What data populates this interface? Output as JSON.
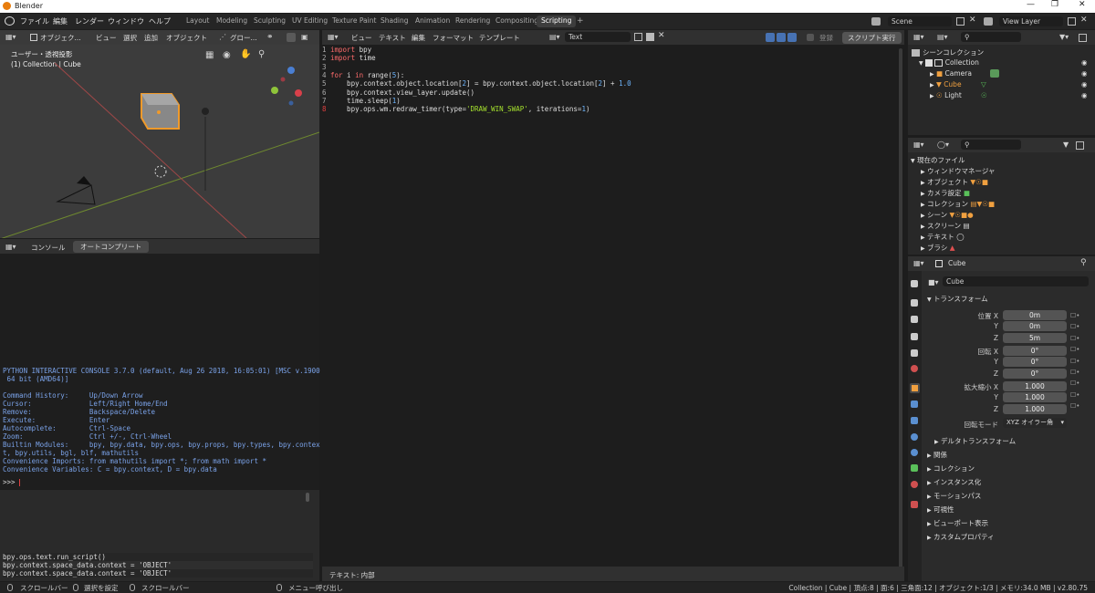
{
  "window": {
    "title": "Blender"
  },
  "menu": [
    "ファイル",
    "編集",
    "レンダー",
    "ウィンドウ",
    "ヘルプ"
  ],
  "workspaces": [
    "Layout",
    "Modeling",
    "Sculpting",
    "UV Editing",
    "Texture Paint",
    "Shading",
    "Animation",
    "Rendering",
    "Compositing",
    "Scripting"
  ],
  "active_workspace": "Scripting",
  "scene_name": "Scene",
  "view_layer": "View Layer",
  "viewport": {
    "mode": "オブジェク...",
    "menus": [
      "ビュー",
      "選択",
      "追加",
      "オブジェクト"
    ],
    "transform": "グロー...",
    "title": "ユーザー・透視投影",
    "subtitle": "(1) Collection | Cube"
  },
  "text_editor": {
    "menus": [
      "ビュー",
      "テキスト",
      "編集",
      "フォーマット",
      "テンプレート"
    ],
    "text_name": "Text",
    "register_label": "登録",
    "run_button": "スクリプト実行",
    "footer": "テキスト: 内部",
    "lines": [
      {
        "n": "1",
        "code": "import bpy"
      },
      {
        "n": "2",
        "code": "import time"
      },
      {
        "n": "3",
        "code": ""
      },
      {
        "n": "4",
        "code": "for i in range(5):"
      },
      {
        "n": "5",
        "code": "    bpy.context.object.location[2] = bpy.context.object.location[2] + 1.0"
      },
      {
        "n": "6",
        "code": "    bpy.context.view_layer.update()"
      },
      {
        "n": "7",
        "code": "    time.sleep(1)"
      },
      {
        "n": "8",
        "code": "    bpy.ops.wm.redraw_timer(type='DRAW_WIN_SWAP', iterations=1)"
      }
    ]
  },
  "console": {
    "tabs": [
      "コンソール",
      "オートコンプリート"
    ],
    "lines": [
      "PYTHON INTERACTIVE CONSOLE 3.7.0 (default, Aug 26 2018, 16:05:01) [MSC v.1900",
      " 64 bit (AMD64)]",
      "",
      "Command History:     Up/Down Arrow",
      "Cursor:              Left/Right Home/End",
      "Remove:              Backspace/Delete",
      "Execute:             Enter",
      "Autocomplete:        Ctrl-Space",
      "Zoom:                Ctrl +/-, Ctrl-Wheel",
      "Builtin Modules:     bpy, bpy.data, bpy.ops, bpy.props, bpy.types, bpy.contex",
      "t, bpy.utils, bgl, blf, mathutils",
      "Convenience Imports: from mathutils import *; from math import *",
      "Convenience Variables: C = bpy.context, D = bpy.data"
    ],
    "prompt": ">>> ",
    "info_lines": [
      "bpy.ops.text.run_script()",
      "bpy.context.space_data.context = 'OBJECT'",
      "bpy.context.space_data.context = 'OBJECT'"
    ]
  },
  "outliner": {
    "scene_collection": "シーンコレクション",
    "collection": "Collection",
    "items": [
      "Camera",
      "Cube",
      "Light"
    ]
  },
  "file_browser": {
    "title": "現在のファイル",
    "items": [
      "ウィンドウマネージャ",
      "オブジェクト",
      "カメラ設定",
      "コレクション",
      "シーン",
      "スクリーン",
      "テキスト",
      "ブラシ"
    ]
  },
  "properties": {
    "object_name": "Cube",
    "data_name": "Cube",
    "transform_title": "トランスフォーム",
    "location_label": "位置 X",
    "rotation_label": "回転 X",
    "scale_label": "拡大縮小 X",
    "y": "Y",
    "z": "Z",
    "location": [
      "0m",
      "0m",
      "5m"
    ],
    "rotation": [
      "0°",
      "0°",
      "0°"
    ],
    "scale": [
      "1.000",
      "1.000",
      "1.000"
    ],
    "rotation_mode_label": "回転モード",
    "rotation_mode": "XYZ オイラー角",
    "delta": "デルタトランスフォーム",
    "panels": [
      "関係",
      "コレクション",
      "インスタンス化",
      "モーションパス",
      "可視性",
      "ビューポート表示",
      "カスタムプロパティ"
    ]
  },
  "statusbar": {
    "items": [
      "スクロールバー",
      "選択を設定",
      "スクロールバー",
      "メニュー呼び出し"
    ],
    "info": "Collection | Cube | 頂点:8 | 面:6 | 三角面:12 | オブジェクト:1/3 | メモリ:34.0 MB | v2.80.75"
  }
}
